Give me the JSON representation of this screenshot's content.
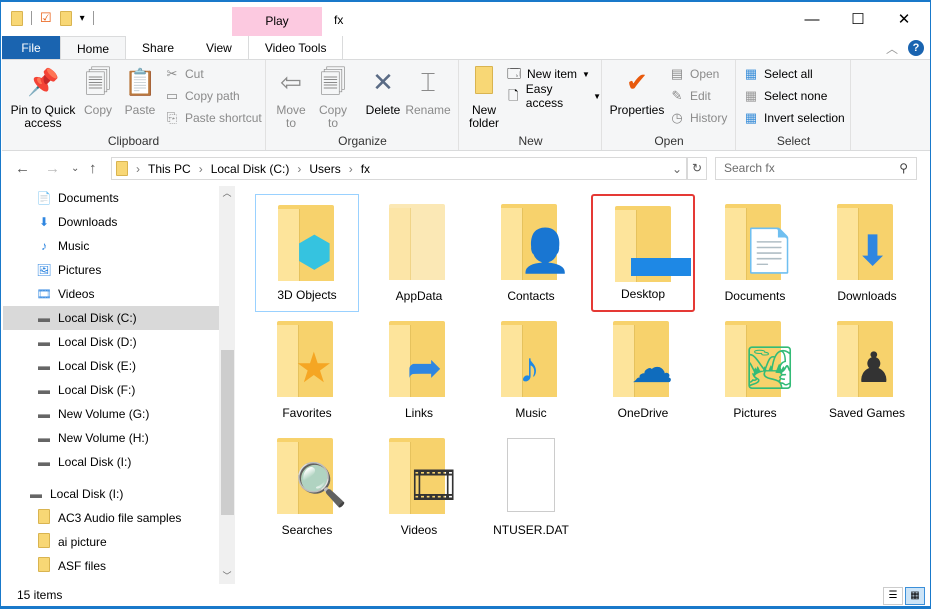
{
  "titlebar": {
    "title": "fx",
    "context_tab": "Play",
    "minimize": "—",
    "maximize": "☐",
    "close": "✕"
  },
  "tabs": [
    "File",
    "Home",
    "Share",
    "View",
    "Video Tools"
  ],
  "ribbon": {
    "clipboard": {
      "label": "Clipboard",
      "pin": "Pin to Quick access",
      "copy": "Copy",
      "paste": "Paste",
      "cut": "Cut",
      "copy_path": "Copy path",
      "paste_shortcut": "Paste shortcut"
    },
    "organize": {
      "label": "Organize",
      "move_to": "Move to",
      "copy_to": "Copy to",
      "delete": "Delete",
      "rename": "Rename"
    },
    "new": {
      "label": "New",
      "new_folder": "New folder",
      "new_item": "New item",
      "easy_access": "Easy access"
    },
    "open": {
      "label": "Open",
      "properties": "Properties",
      "open": "Open",
      "edit": "Edit",
      "history": "History"
    },
    "select": {
      "label": "Select",
      "select_all": "Select all",
      "select_none": "Select none",
      "invert": "Invert selection"
    }
  },
  "address": {
    "crumbs": [
      "This PC",
      "Local Disk (C:)",
      "Users",
      "fx"
    ],
    "search_placeholder": "Search fx"
  },
  "sidebar": [
    {
      "label": "Documents",
      "icon": "📄"
    },
    {
      "label": "Downloads",
      "icon": "⬇"
    },
    {
      "label": "Music",
      "icon": "♪"
    },
    {
      "label": "Pictures",
      "icon": "🖼"
    },
    {
      "label": "Videos",
      "icon": "🎞"
    },
    {
      "label": "Local Disk (C:)",
      "icon": "▬"
    },
    {
      "label": "Local Disk (D:)",
      "icon": "▬"
    },
    {
      "label": "Local Disk (E:)",
      "icon": "▬"
    },
    {
      "label": "Local Disk (F:)",
      "icon": "▬"
    },
    {
      "label": "New Volume (G:)",
      "icon": "▬"
    },
    {
      "label": "New Volume (H:)",
      "icon": "▬"
    },
    {
      "label": "Local Disk (I:)",
      "icon": "▬"
    },
    {
      "label": "Local Disk (I:)",
      "icon": "▬"
    },
    {
      "label": "AC3 Audio file samples",
      "icon": "📁"
    },
    {
      "label": "ai picture",
      "icon": "📁"
    },
    {
      "label": "ASF files",
      "icon": "📁"
    }
  ],
  "items": [
    {
      "label": "3D Objects",
      "overlay": "⬢",
      "color": "#35c3e0"
    },
    {
      "label": "AppData",
      "overlay": "",
      "color": "#999"
    },
    {
      "label": "Contacts",
      "overlay": "👤",
      "color": "#4a90d9"
    },
    {
      "label": "Desktop",
      "overlay": "▬",
      "color": "#1e88e5"
    },
    {
      "label": "Documents",
      "overlay": "📄",
      "color": "#555"
    },
    {
      "label": "Downloads",
      "overlay": "⬇",
      "color": "#2f86e0"
    },
    {
      "label": "Favorites",
      "overlay": "★",
      "color": "#f5a623"
    },
    {
      "label": "Links",
      "overlay": "➦",
      "color": "#2f86e0"
    },
    {
      "label": "Music",
      "overlay": "♪",
      "color": "#1e88e5"
    },
    {
      "label": "OneDrive",
      "overlay": "☁",
      "color": "#0f6cbd"
    },
    {
      "label": "Pictures",
      "overlay": "🏞",
      "color": "#3b7"
    },
    {
      "label": "Saved Games",
      "overlay": "♟",
      "color": "#333"
    },
    {
      "label": "Searches",
      "overlay": "🔍",
      "color": "#555"
    },
    {
      "label": "Videos",
      "overlay": "🎞",
      "color": "#333"
    },
    {
      "label": "NTUSER.DAT",
      "overlay": "",
      "color": "#ccc"
    }
  ],
  "status": {
    "count": "15 items"
  },
  "colors": {
    "accent": "#1a64b0",
    "selected_border": "#e53935",
    "context_tab": "#fcc9e0"
  }
}
